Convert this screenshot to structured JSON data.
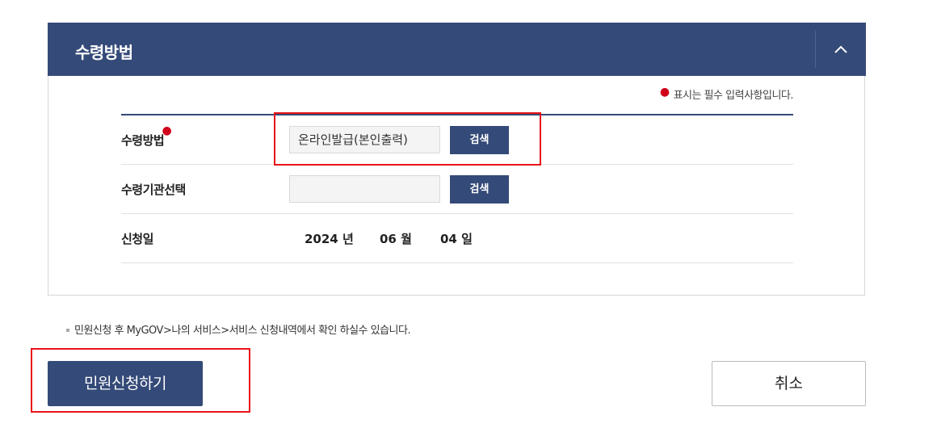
{
  "section": {
    "title": "수령방법",
    "required_note": "표시는 필수 입력사항입니다."
  },
  "form": {
    "receipt_method": {
      "label": "수령방법",
      "value": "온라인발급(본인출력)",
      "button": "검색"
    },
    "receipt_agency": {
      "label": "수령기관선택",
      "value": "",
      "button": "검색"
    },
    "application_date": {
      "label": "신청일",
      "year": "2024 년",
      "month": "06 월",
      "day": "04 일"
    }
  },
  "notice": "민원신청 후 MyGOV>나의 서비스>서비스 신청내역에서 확인 하실수 있습니다.",
  "buttons": {
    "submit": "민원신청하기",
    "cancel": "취소"
  },
  "colors": {
    "primary": "#344a78",
    "required_dot": "#d0021b",
    "highlight": "#e8141a"
  }
}
